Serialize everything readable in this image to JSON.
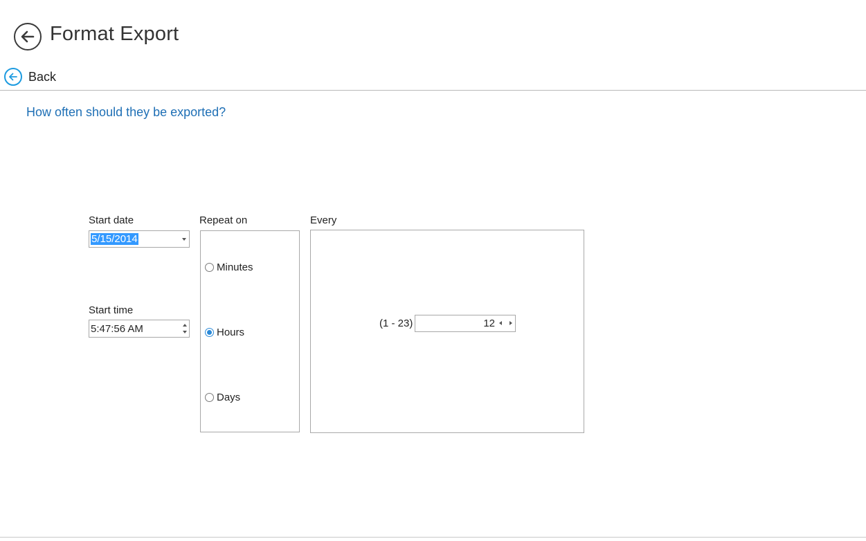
{
  "header": {
    "title": "Format Export",
    "back_label": "Back",
    "back_icon": "arrow-left-circle-icon"
  },
  "page": {
    "question": "How often should they be exported?"
  },
  "schedule": {
    "start_date_label": "Start date",
    "start_date_value": "5/15/2014",
    "start_time_label": "Start time",
    "start_time_value": "5:47:56 AM"
  },
  "repeat": {
    "label": "Repeat on",
    "options": [
      {
        "label": "Minutes",
        "selected": false
      },
      {
        "label": "Hours",
        "selected": true
      },
      {
        "label": "Days",
        "selected": false
      }
    ]
  },
  "every": {
    "label": "Every",
    "range": "(1 - 23)",
    "value": "12"
  },
  "colors": {
    "accent": "#1d9be0",
    "question_text": "#1e6fb5",
    "selection": "#3399ff"
  }
}
